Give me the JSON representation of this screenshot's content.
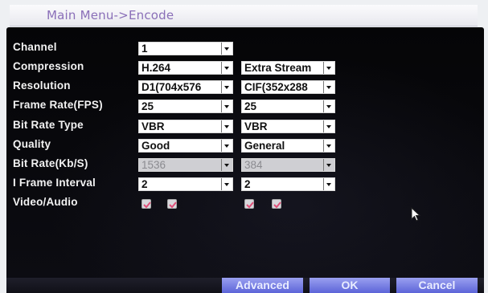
{
  "title": "Main Menu->Encode",
  "fields": [
    {
      "label": "Channel",
      "main": {
        "value": "1"
      },
      "extra": null
    },
    {
      "label": "Compression",
      "main": {
        "value": "H.264"
      },
      "extra": {
        "value": "Extra Stream"
      }
    },
    {
      "label": "Resolution",
      "main": {
        "value": "D1(704x576"
      },
      "extra": {
        "value": "CIF(352x288"
      }
    },
    {
      "label": "Frame Rate(FPS)",
      "main": {
        "value": "25"
      },
      "extra": {
        "value": "25"
      }
    },
    {
      "label": "Bit Rate Type",
      "main": {
        "value": "VBR"
      },
      "extra": {
        "value": "VBR"
      }
    },
    {
      "label": "Quality",
      "main": {
        "value": "Good"
      },
      "extra": {
        "value": "General"
      }
    },
    {
      "label": "Bit Rate(Kb/S)",
      "main": {
        "value": "1536"
      },
      "extra": {
        "value": "384"
      }
    },
    {
      "label": "I Frame Interval",
      "main": {
        "value": "2"
      },
      "extra": {
        "value": "2"
      }
    },
    {
      "label": "Video/Audio"
    }
  ],
  "video_audio": {
    "main": {
      "video": true,
      "audio": true
    },
    "extra": {
      "video": true,
      "audio": true
    }
  },
  "buttons": {
    "advanced": "Advanced",
    "ok": "OK",
    "cancel": "Cancel"
  },
  "colors": {
    "title": "#8a6fb8",
    "panel": "#000000",
    "button": "#6a72e0",
    "check": "#e0507a"
  }
}
